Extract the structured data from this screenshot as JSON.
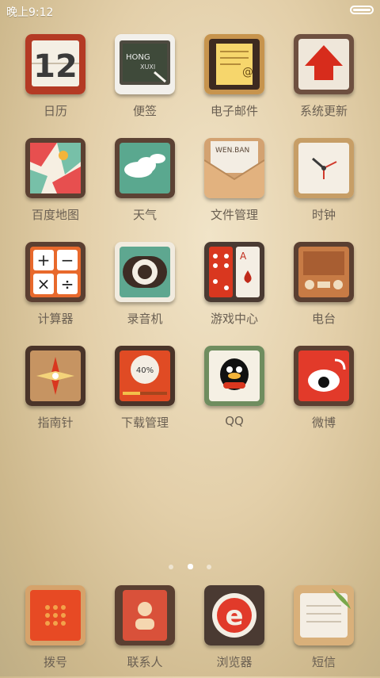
{
  "status": {
    "time": "晚上9:12",
    "battery_level": 1.0
  },
  "apps": [
    {
      "label": "日历",
      "icon": "calendar-icon",
      "date_number": "12"
    },
    {
      "label": "便签",
      "icon": "notes-icon",
      "board_text_1": "HONG",
      "board_text_2": "XUXI"
    },
    {
      "label": "电子邮件",
      "icon": "email-icon",
      "at_symbol": "@"
    },
    {
      "label": "系统更新",
      "icon": "system-update-icon"
    },
    {
      "label": "百度地图",
      "icon": "map-icon"
    },
    {
      "label": "天气",
      "icon": "weather-icon"
    },
    {
      "label": "文件管理",
      "icon": "file-manager-icon",
      "folder_text": "WEN.BAN"
    },
    {
      "label": "时钟",
      "icon": "clock-icon"
    },
    {
      "label": "计算器",
      "icon": "calculator-icon",
      "keys": [
        "+",
        "−",
        "×",
        "÷"
      ]
    },
    {
      "label": "录音机",
      "icon": "recorder-icon"
    },
    {
      "label": "游戏中心",
      "icon": "game-center-icon",
      "card_letter": "A"
    },
    {
      "label": "电台",
      "icon": "radio-icon"
    },
    {
      "label": "指南针",
      "icon": "compass-icon"
    },
    {
      "label": "下载管理",
      "icon": "download-manager-icon",
      "progress_text": "40%"
    },
    {
      "label": "QQ",
      "icon": "qq-icon"
    },
    {
      "label": "微博",
      "icon": "weibo-icon"
    }
  ],
  "page_indicator": {
    "count": 3,
    "active": 1
  },
  "dock": [
    {
      "label": "拨号",
      "icon": "dialer-icon"
    },
    {
      "label": "联系人",
      "icon": "contacts-icon"
    },
    {
      "label": "浏览器",
      "icon": "browser-icon",
      "letter": "e"
    },
    {
      "label": "短信",
      "icon": "messages-icon"
    }
  ]
}
